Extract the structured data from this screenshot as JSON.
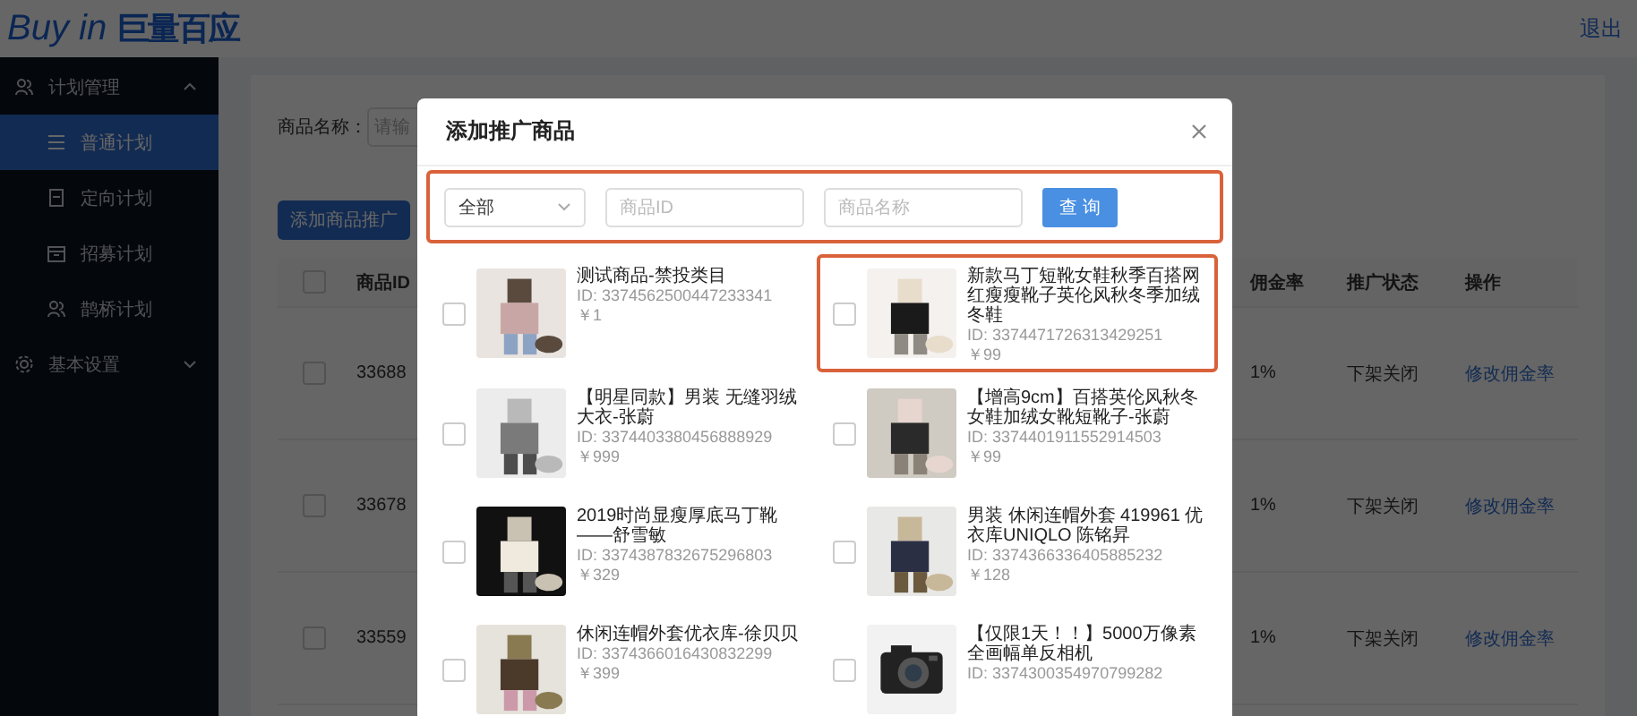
{
  "header": {
    "logo_latin": "Buy in",
    "logo_cn": "巨量百应",
    "logout": "退出"
  },
  "sidebar": {
    "items": [
      {
        "label": "计划管理",
        "expanded": true,
        "children": [
          {
            "label": "普通计划",
            "selected": true
          },
          {
            "label": "定向计划",
            "selected": false
          },
          {
            "label": "招募计划",
            "selected": false
          },
          {
            "label": "鹊桥计划",
            "selected": false
          }
        ]
      },
      {
        "label": "基本设置",
        "expanded": false
      }
    ]
  },
  "filter": {
    "label": "商品名称：",
    "placeholder": "请输"
  },
  "add_button": "添加商品推广",
  "table": {
    "columns": [
      "商品ID",
      "佣金率",
      "推广状态",
      "操作"
    ],
    "all_checked": false,
    "rows": [
      {
        "checked": false,
        "id": "33688",
        "rate": "1%",
        "status": "下架关闭",
        "action": "修改佣金率"
      },
      {
        "checked": false,
        "id": "33678",
        "rate": "1%",
        "status": "下架关闭",
        "action": "修改佣金率"
      },
      {
        "checked": false,
        "id": "33559",
        "rate": "1%",
        "status": "下架关闭",
        "action": "修改佣金率"
      }
    ]
  },
  "dialog": {
    "title": "添加推广商品",
    "search": {
      "highlighted": true,
      "category": "全部",
      "id_placeholder": "商品ID",
      "name_placeholder": "商品名称",
      "button": "查 询"
    },
    "products": [
      {
        "title": "测试商品-禁投类目",
        "id": "ID: 3374562500447233341",
        "price": "￥1",
        "checked": false,
        "highlighted": false
      },
      {
        "title": "新款马丁短靴女鞋秋季百搭网红瘦瘦靴子英伦风秋冬季加绒冬鞋",
        "id": "ID: 3374471726313429251",
        "price": "￥99",
        "checked": false,
        "highlighted": true
      },
      {
        "title": "【明星同款】男装 无缝羽绒大衣-张蔚",
        "id": "ID: 3374403380456888929",
        "price": "￥999",
        "checked": false,
        "highlighted": false
      },
      {
        "title": "【增高9cm】百搭英伦风秋冬女鞋加绒女靴短靴子-张蔚",
        "id": "ID: 3374401911552914503",
        "price": "￥99",
        "checked": false,
        "highlighted": false
      },
      {
        "title": "2019时尚显瘦厚底马丁靴——舒雪敏",
        "id": "ID: 3374387832675296803",
        "price": "￥329",
        "checked": false,
        "highlighted": false
      },
      {
        "title": "男装 休闲连帽外套 419961 优衣库UNIQLO 陈铭昇",
        "id": "ID: 3374366336405885232",
        "price": "￥128",
        "checked": false,
        "highlighted": false
      },
      {
        "title": "休闲连帽外套优衣库-徐贝贝",
        "id": "ID: 3374366016430832299",
        "price": "￥399",
        "checked": false,
        "highlighted": false
      },
      {
        "title": "【仅限1天！！】5000万像素全画幅单反相机",
        "id": "ID: 3374300354970799282",
        "checked": false,
        "highlighted": false
      }
    ]
  }
}
